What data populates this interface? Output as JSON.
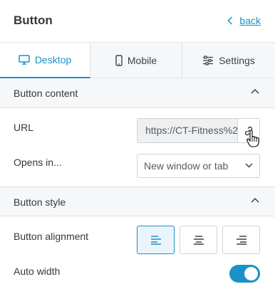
{
  "header": {
    "title": "Button",
    "back_label": "back"
  },
  "tabs": [
    {
      "label": "Desktop",
      "icon": "desktop-icon",
      "active": true
    },
    {
      "label": "Mobile",
      "icon": "mobile-icon",
      "active": false
    },
    {
      "label": "Settings",
      "icon": "sliders-icon",
      "active": false
    }
  ],
  "sections": {
    "content": {
      "title": "Button content",
      "expanded": true
    },
    "style": {
      "title": "Button style",
      "expanded": true
    }
  },
  "fields": {
    "url_label": "URL",
    "url_value": "https://CT-Fitness%2",
    "opens_label": "Opens in...",
    "opens_value": "New window or tab",
    "alignment_label": "Button alignment",
    "alignment_selected": "left",
    "autowidth_label": "Auto width",
    "autowidth_on": true
  },
  "colors": {
    "accent": "#1a91c9",
    "panel": "#f6f7f8",
    "border": "#cfd4d8"
  }
}
